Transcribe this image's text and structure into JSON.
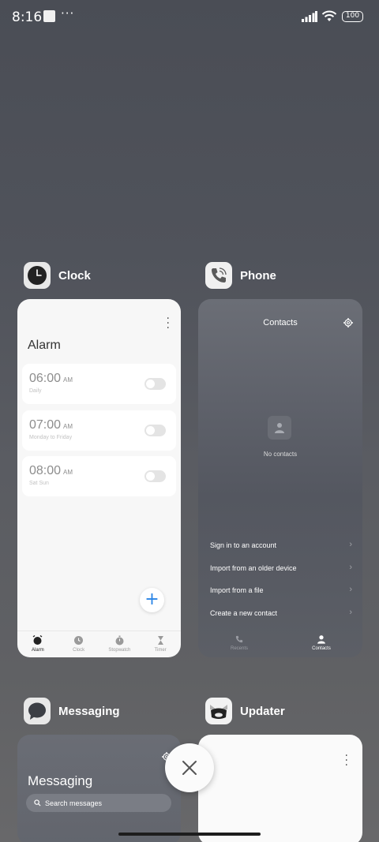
{
  "status_bar": {
    "time": "8:16",
    "more": "···",
    "battery": "100"
  },
  "apps": {
    "clock": {
      "name": "Clock",
      "screen_title": "Alarm",
      "alarms": [
        {
          "time": "06:00",
          "ampm": "AM",
          "repeat": "Daily",
          "enabled": false
        },
        {
          "time": "07:00",
          "ampm": "AM",
          "repeat": "Monday to Friday",
          "enabled": false
        },
        {
          "time": "08:00",
          "ampm": "AM",
          "repeat": "Sat Sun",
          "enabled": false
        }
      ],
      "add_label": "+",
      "nav": [
        "Alarm",
        "Clock",
        "Stopwatch",
        "Timer"
      ]
    },
    "phone": {
      "name": "Phone",
      "screen_title": "Contacts",
      "empty_text": "No contacts",
      "options": [
        "Sign in to an account",
        "Import from an older device",
        "Import from a file",
        "Create a new contact"
      ],
      "chevron": "›",
      "nav": [
        "Recents",
        "Contacts"
      ]
    },
    "messaging": {
      "name": "Messaging",
      "screen_title": "Messaging",
      "search_placeholder": "Search messages"
    },
    "updater": {
      "name": "Updater"
    }
  },
  "colors": {
    "accent": "#2a85e6",
    "card_light": "#f7f7f7",
    "icon_dark": "#222222"
  }
}
